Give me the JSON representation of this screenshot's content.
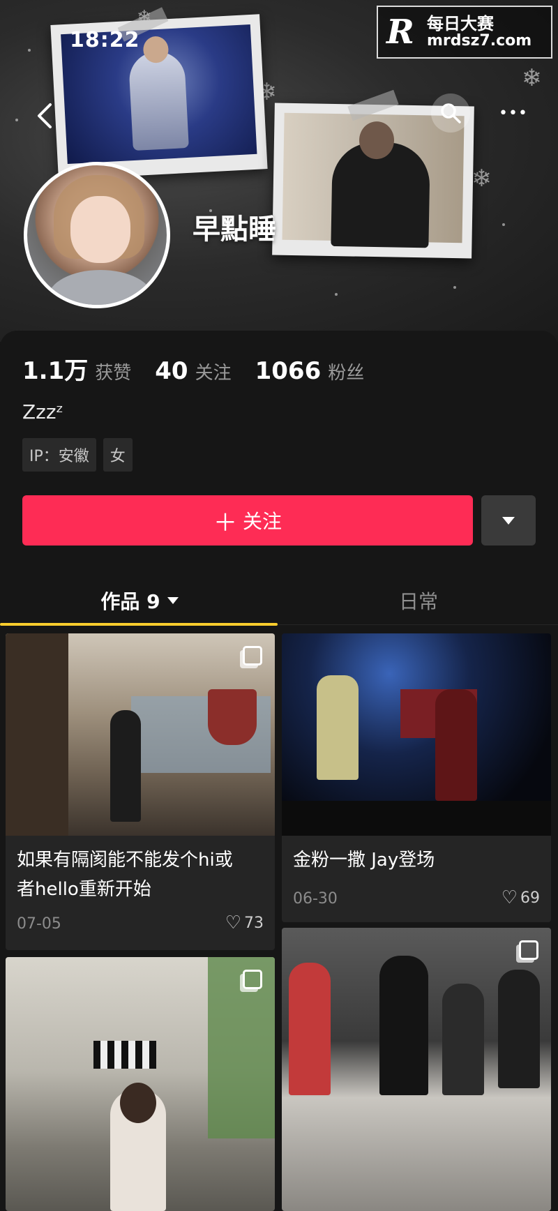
{
  "status_bar": {
    "time": "18:22"
  },
  "watermark": {
    "mark": "R",
    "name": "每日大赛",
    "url": "mrdsz7.com"
  },
  "header": {
    "back_glyph": "‹",
    "more_glyph": "•••"
  },
  "profile": {
    "nickname": "早點睡",
    "stats": [
      {
        "value": "1.1万",
        "label": "获赞"
      },
      {
        "value": "40",
        "label": "关注"
      },
      {
        "value": "1066",
        "label": "粉丝"
      }
    ],
    "bio": "Zzzᶻ",
    "tags": [
      "IP：安徽",
      "女"
    ]
  },
  "actions": {
    "follow_label": "关注",
    "follow_plus": "＋"
  },
  "tabs": [
    {
      "label": "作品 9",
      "active": true
    },
    {
      "label": "日常",
      "active": false
    }
  ],
  "posts": [
    {
      "title_line1": "如果有隔阂能不能发个hi或",
      "title_line2": "者hello重新开始",
      "date": "07-05",
      "likes": "73"
    },
    {
      "title_line1": "金粉一撒 Jay登场",
      "date": "06-30",
      "likes": "69"
    }
  ],
  "colors": {
    "accent": "#fe2c55",
    "tab_indicator": "#facd2d",
    "background": "#161616"
  }
}
